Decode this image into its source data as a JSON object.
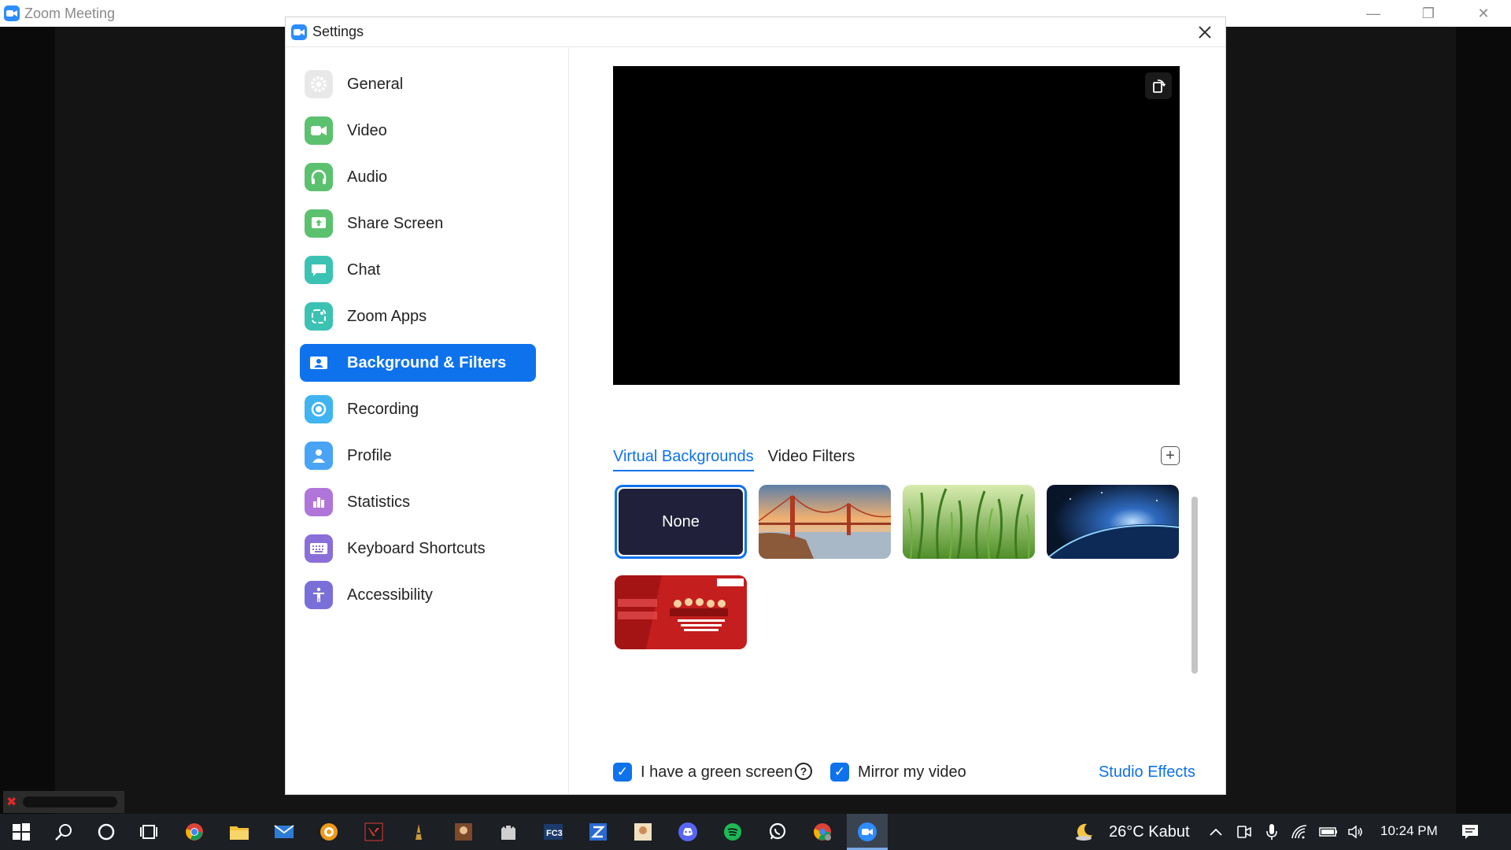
{
  "window": {
    "title": "Zoom Meeting",
    "controls": [
      "minimize",
      "restore",
      "close"
    ]
  },
  "settings": {
    "title": "Settings",
    "nav": [
      {
        "label": "General",
        "icon": "gear-icon",
        "color": "#e5e5e5",
        "active": false
      },
      {
        "label": "Video",
        "icon": "video-camera-icon",
        "color": "#5cc16e",
        "active": false
      },
      {
        "label": "Audio",
        "icon": "headphones-icon",
        "color": "#5cc16e",
        "active": false
      },
      {
        "label": "Share Screen",
        "icon": "share-screen-icon",
        "color": "#5cc16e",
        "active": false
      },
      {
        "label": "Chat",
        "icon": "chat-bubble-icon",
        "color": "#3cc2b3",
        "active": false
      },
      {
        "label": "Zoom Apps",
        "icon": "apps-icon",
        "color": "#3cc2b3",
        "active": false
      },
      {
        "label": "Background & Filters",
        "icon": "person-card-icon",
        "color": "#0e72ed",
        "active": true
      },
      {
        "label": "Recording",
        "icon": "record-icon",
        "color": "#40b4f0",
        "active": false
      },
      {
        "label": "Profile",
        "icon": "person-icon",
        "color": "#4aa4f5",
        "active": false
      },
      {
        "label": "Statistics",
        "icon": "bar-chart-icon",
        "color": "#b075d9",
        "active": false
      },
      {
        "label": "Keyboard Shortcuts",
        "icon": "keyboard-icon",
        "color": "#8a6fd8",
        "active": false
      },
      {
        "label": "Accessibility",
        "icon": "accessibility-icon",
        "color": "#7a6fd8",
        "active": false
      }
    ],
    "tabs": [
      {
        "label": "Virtual Backgrounds",
        "active": true
      },
      {
        "label": "Video Filters",
        "active": false
      }
    ],
    "backgrounds": [
      {
        "label": "None",
        "selected": true
      },
      {
        "label": "",
        "kind": "golden-gate-bridge"
      },
      {
        "label": "",
        "kind": "grass"
      },
      {
        "label": "",
        "kind": "earth-from-space"
      },
      {
        "label": "",
        "kind": "custom-red-banner"
      }
    ],
    "options": {
      "green_screen_label": "I have a green screen",
      "mirror_label": "Mirror my video",
      "studio_effects_label": "Studio Effects"
    }
  },
  "taskbar": {
    "weather": "26°C  Kabut",
    "time": "10:24 PM"
  }
}
